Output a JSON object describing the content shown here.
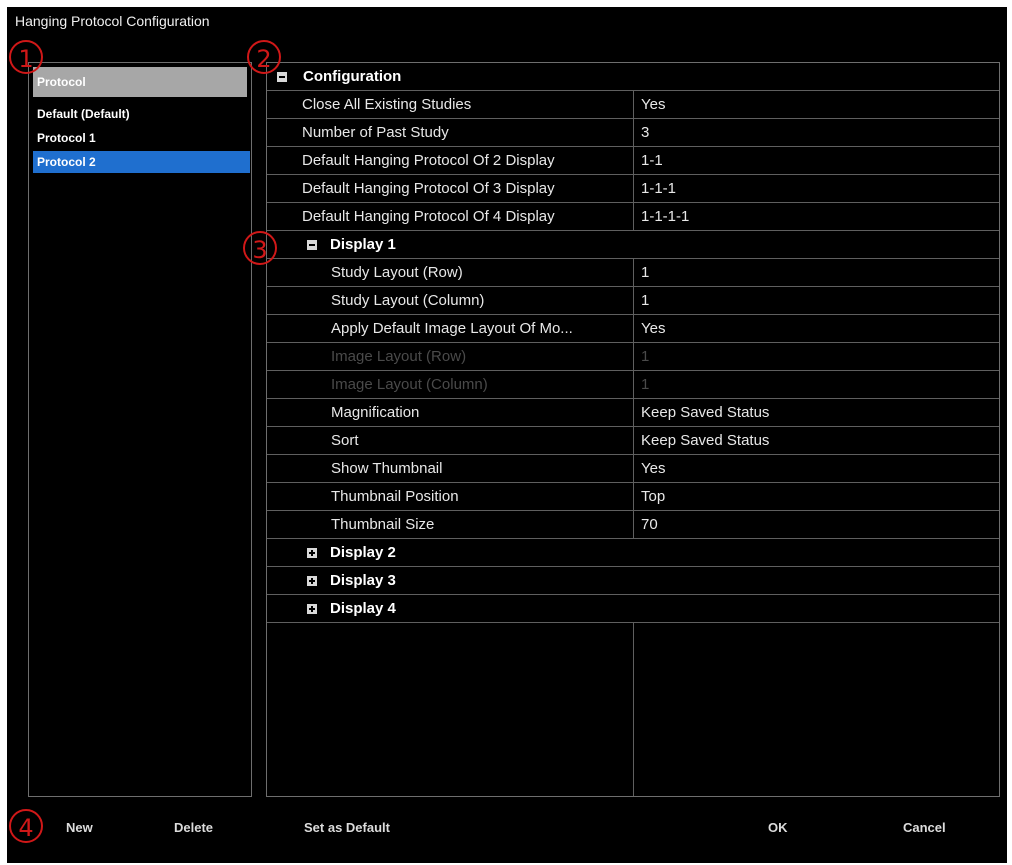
{
  "window": {
    "title": "Hanging Protocol Configuration"
  },
  "protocol_panel": {
    "header": "Protocol",
    "items": [
      {
        "label": "Default (Default)"
      },
      {
        "label": "Protocol 1"
      },
      {
        "label": "Protocol 2",
        "selected": true
      }
    ]
  },
  "config": {
    "section_title": "Configuration",
    "rows": [
      {
        "name": "Close All Existing Studies",
        "value": "Yes"
      },
      {
        "name": "Number of Past Study",
        "value": "3"
      },
      {
        "name": "Default Hanging Protocol Of 2 Display",
        "value": "1-1"
      },
      {
        "name": "Default Hanging Protocol Of 3 Display",
        "value": "1-1-1"
      },
      {
        "name": "Default Hanging Protocol Of 4 Display",
        "value": "1-1-1-1"
      }
    ],
    "display1": {
      "title": "Display 1",
      "rows": [
        {
          "name": "Study Layout (Row)",
          "value": "1"
        },
        {
          "name": "Study Layout (Column)",
          "value": "1"
        },
        {
          "name": "Apply Default Image Layout Of Mo...",
          "value": "Yes"
        },
        {
          "name": "Image Layout (Row)",
          "value": "1",
          "disabled": true
        },
        {
          "name": "Image Layout (Column)",
          "value": "1",
          "disabled": true
        },
        {
          "name": "Magnification",
          "value": "Keep Saved Status"
        },
        {
          "name": "Sort",
          "value": "Keep Saved Status"
        },
        {
          "name": "Show Thumbnail",
          "value": "Yes"
        },
        {
          "name": "Thumbnail Position",
          "value": "Top"
        },
        {
          "name": "Thumbnail Size",
          "value": "70"
        }
      ]
    },
    "collapsed_displays": [
      "Display 2",
      "Display 3",
      "Display 4"
    ]
  },
  "annotations": {
    "n1": "1",
    "n2": "2",
    "n3": "3",
    "n4": "4"
  },
  "buttons": {
    "new": "New",
    "delete": "Delete",
    "set_default": "Set as Default",
    "ok": "OK",
    "cancel": "Cancel"
  },
  "colors": {
    "selection": "#1f6fcf",
    "annotation": "#d01818",
    "header": "#a7a7a7"
  }
}
